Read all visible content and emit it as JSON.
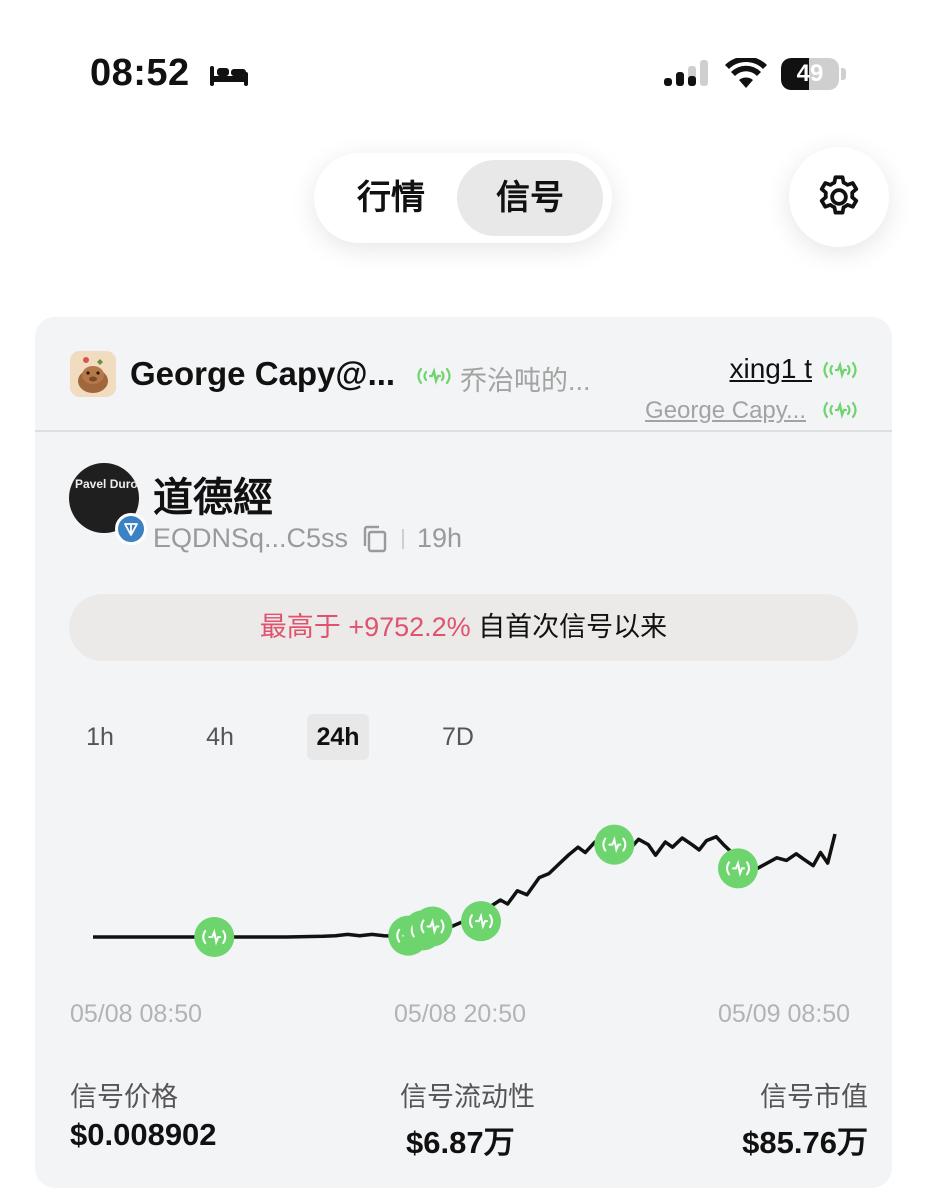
{
  "status_bar": {
    "time": "08:52",
    "battery_level": "49",
    "battery_fraction": 0.49,
    "icons": [
      "bed-icon",
      "cellular-signal-icon",
      "wifi-icon",
      "battery-icon"
    ]
  },
  "header": {
    "tabs": [
      {
        "label": "行情",
        "active": false
      },
      {
        "label": "信号",
        "active": true
      }
    ],
    "settings_icon": "gear-icon"
  },
  "card": {
    "kol": {
      "name": "George Capy@...",
      "description": "乔治吨的...",
      "link_primary": "xing1 t",
      "link_secondary": "George Capy..."
    },
    "token": {
      "name": "道德經",
      "avatar_text": "Pavel Durov",
      "address": "EQDNSq...C5ss",
      "age": "19h"
    },
    "banner": {
      "prefix": "最高于 ",
      "value": "+9752.2%",
      "suffix": " 自首次信号以来"
    },
    "timeframes": [
      {
        "label": "1h",
        "active": false
      },
      {
        "label": "4h",
        "active": false
      },
      {
        "label": "24h",
        "active": true
      },
      {
        "label": "7D",
        "active": false
      }
    ],
    "stats": [
      {
        "label": "信号价格",
        "value": "$0.008902"
      },
      {
        "label": "信号流动性",
        "value": "$6.87万"
      },
      {
        "label": "信号市值",
        "value": "$85.76万"
      }
    ]
  },
  "colors": {
    "signal_green": "#6dd46e",
    "highlight_pink": "#e0526e",
    "line": "#111111"
  },
  "chart_data": {
    "type": "line",
    "x_ticks": [
      "05/08 08:50",
      "05/08 20:50",
      "05/09 08:50"
    ],
    "x_range": [
      0,
      24
    ],
    "y_range": [
      0,
      100
    ],
    "series": [
      {
        "points": [
          [
            0,
            0
          ],
          [
            2,
            0
          ],
          [
            4,
            0
          ],
          [
            6,
            0
          ],
          [
            8,
            0
          ],
          [
            9.5,
            0.5
          ],
          [
            10,
            1
          ],
          [
            10.5,
            2
          ],
          [
            11,
            1
          ],
          [
            11.5,
            2
          ],
          [
            12,
            1
          ],
          [
            12.5,
            0.5
          ],
          [
            13,
            1
          ],
          [
            13.6,
            5
          ],
          [
            14.2,
            10
          ],
          [
            14.8,
            8
          ],
          [
            15.3,
            12
          ],
          [
            15.9,
            15
          ],
          [
            16.3,
            22
          ],
          [
            16.8,
            28
          ],
          [
            17.1,
            25
          ],
          [
            17.5,
            35
          ],
          [
            17.9,
            32
          ],
          [
            18.4,
            45
          ],
          [
            18.8,
            48
          ],
          [
            19.2,
            55
          ],
          [
            19.6,
            62
          ],
          [
            20.0,
            68
          ],
          [
            20.3,
            64
          ],
          [
            20.7,
            72
          ],
          [
            21.0,
            70
          ],
          [
            21.4,
            78
          ],
          [
            21.7,
            74
          ],
          [
            22.1,
            66
          ],
          [
            22.5,
            74
          ],
          [
            22.9,
            70
          ],
          [
            23.2,
            62
          ],
          [
            23.6,
            72
          ],
          [
            23.9,
            68
          ],
          [
            24.3,
            75
          ],
          [
            24.7,
            70
          ],
          [
            25.0,
            66
          ],
          [
            25.3,
            73
          ],
          [
            25.7,
            76
          ],
          [
            26.0,
            70
          ],
          [
            26.4,
            63
          ],
          [
            26.7,
            55
          ],
          [
            27.1,
            59
          ],
          [
            27.4,
            52
          ],
          [
            27.8,
            56
          ],
          [
            28.2,
            60
          ],
          [
            28.6,
            58
          ],
          [
            29.0,
            63
          ],
          [
            29.3,
            59
          ],
          [
            29.7,
            54
          ],
          [
            30.0,
            64
          ],
          [
            30.3,
            56
          ],
          [
            30.6,
            78
          ]
        ]
      }
    ],
    "signal_markers": [
      {
        "x": 5.0,
        "y": 0
      },
      {
        "x": 13.0,
        "y": 1
      },
      {
        "x": 13.6,
        "y": 5
      },
      {
        "x": 14.0,
        "y": 8
      },
      {
        "x": 16.0,
        "y": 12
      },
      {
        "x": 21.5,
        "y": 70
      },
      {
        "x": 26.6,
        "y": 52
      }
    ]
  }
}
